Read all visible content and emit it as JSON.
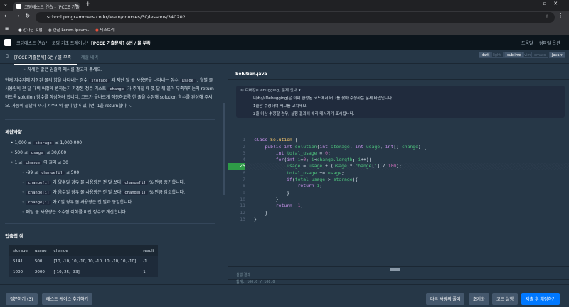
{
  "browser": {
    "tab_title": "코딩테스트 연습 - [PCCE 기출",
    "url": "school.programmers.co.kr/learn/courses/30/lessons/340202",
    "bookmarks": [
      "강사님 깃헙",
      "한글 Lorem ipsum...",
      "티스토리"
    ]
  },
  "nav": {
    "breadcrumb": [
      "코딩테스트 연습",
      "코딩 기초 트레이닝",
      "[PCCE 기출문제] 6번 / 물 부족"
    ],
    "help": "도움말",
    "compile_options": "컴파일 옵션"
  },
  "problem_header": {
    "title": "[PCCE 기출문제] 6번 / 물 부족",
    "submissions": "제출 내역"
  },
  "editor_options": {
    "themes": [
      "dark",
      "light"
    ],
    "keymaps": [
      "sublime",
      "vim",
      "emacs"
    ],
    "language": "Java"
  },
  "description": {
    "note": "자세한 값은 입출력 예시를 참고해 주세요.",
    "p1": "현재 저수지에 저장된 물의 양을 나타내는 정수",
    "storage": "storage",
    "p2": "와 지난 달 물 사용량을 나타내는 정수",
    "usage": "usage",
    "p3": ", 월별 물 사용량이 전 달 대비 어떻게 변하는지 저장된 정수 리스트",
    "change": "change",
    "p4": "가 주어질 때 몇 달 뒤 물이 부족해지는지 return 하도록 solution 함수를 작성하려 합니다. 코드가 올바르게 작동하도록 한 줄을 수정해 solution 함수를 완성해 주세요. 가뭄이 끝날때 까지 저수지의 물이 남아 있다면 -1을 return합니다."
  },
  "constraints": {
    "title": "제한사항",
    "c1a": "1,000 ≤",
    "c1b": "≤ 1,000,000",
    "c2a": "500 ≤",
    "c2b": "≤ 30,000",
    "c3a": "1 ≤",
    "c3b": "의 길이 ≤ 30",
    "s1a": "-99 ≤",
    "s1b": "≤ 500",
    "ci": "change[i]",
    "s2a": "가 양수일 경우 물 사용량은 전 달 보다",
    "s2b": "% 만큼 증가합니다.",
    "s3a": "가 음수일 경우 물 사용량은 전 달 보다",
    "s3b": "% 만큼 감소합니다.",
    "s4": "가 0일 경우 물 사용량은 전 달과 동일합니다.",
    "s5": "매달 물 사용량은 소수점 이하를 버린 정수로 계산합니다."
  },
  "examples": {
    "title": "입출력 예",
    "headers": [
      "storage",
      "usage",
      "change",
      "result"
    ],
    "rows": [
      [
        "5141",
        "500",
        "[10, -10, 10, -10, 10, -10, 10, -10, 10, -10]",
        "-1"
      ],
      [
        "1000",
        "2000",
        "[-10, 25, -33]",
        "1"
      ]
    ]
  },
  "editor": {
    "filename": "Solution.java",
    "guide_title": "디버깅(Debugging) 문제 안내",
    "guide_lines": [
      "디버깅(Debugging)은 이미 완성된 코드에서 버그를 찾아 수정하는 문제 타입입니다.",
      "1줄만 수정하여 버그를 고치세요.",
      "2줄 이상 수정할 경우, 실행 결과에 에러 메시지가 표시됩니다."
    ],
    "modified_line": "✓5"
  },
  "result": {
    "label": "실행 결과",
    "score": "합계: 100.0 / 100.0"
  },
  "buttons": {
    "ask": "질문하기 (3)",
    "add_test": "테스트 케이스 추가하기",
    "others": "다른 사람의 풀이",
    "reset": "초기화",
    "run": "코드 실행",
    "submit": "제출 후 채점하기"
  },
  "colors": {
    "accent": "#0078ff",
    "bg": "#263747",
    "nav": "#0c151c"
  }
}
